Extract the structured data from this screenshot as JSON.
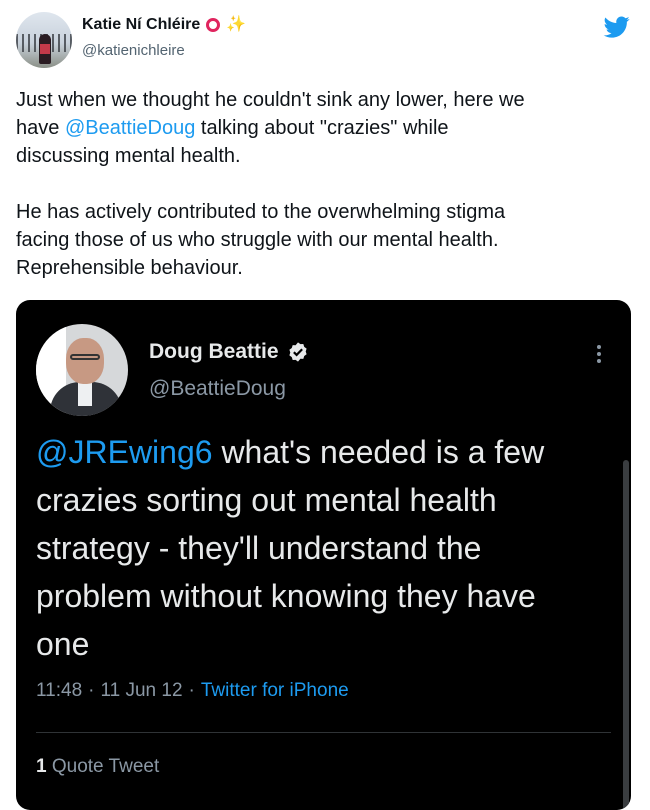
{
  "author": {
    "display_name": "Katie Ní Chléire",
    "handle": "@katienichleire"
  },
  "tweet": {
    "text_before": "Just when we thought he couldn't sink any lower, here we\nhave ",
    "mention": "@BeattieDoug",
    "text_after": " talking about \"crazies\" while\ndiscussing mental health.\n\nHe has actively contributed to the overwhelming stigma\nfacing those of us who struggle with our mental health.\nReprehensible behaviour."
  },
  "embedded": {
    "display_name": "Doug Beattie",
    "handle": "@BeattieDoug",
    "mention": "@JREwing6",
    "text": " what's needed is a few crazies sorting out mental health strategy - they'll understand the problem without knowing they have one",
    "time": "11:48",
    "date": "11 Jun 12",
    "separator": "·",
    "source": "Twitter for iPhone",
    "quote_count": "1",
    "quote_label": "Quote Tweet"
  },
  "colors": {
    "accent": "#1d9bf0",
    "card_bg": "#000000"
  },
  "icons": [
    "twitter-bird-icon",
    "verified-badge-icon",
    "more-options-icon",
    "red-circle-icon",
    "sparkles-icon"
  ]
}
